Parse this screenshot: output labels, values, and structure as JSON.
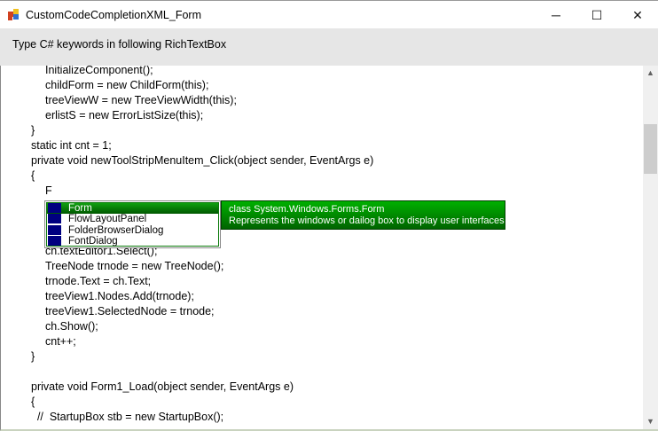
{
  "window": {
    "title": "CustomCodeCompletionXML_Form",
    "minimize": "─",
    "maximize": "☐",
    "close": "✕"
  },
  "header": {
    "label": "Type C# keywords in following RichTextBox"
  },
  "editor": {
    "lines": [
      {
        "text": "InitializeComponent();",
        "indent": 1
      },
      {
        "text": "childForm = new ChildForm(this);",
        "indent": 1
      },
      {
        "text": "treeViewW = new TreeViewWidth(this);",
        "indent": 1
      },
      {
        "text": "erlistS = new ErrorListSize(this);",
        "indent": 1
      },
      {
        "text": "}",
        "indent": 0
      },
      {
        "text": "static int cnt = 1;",
        "indent": 0
      },
      {
        "text": "private void newToolStripMenuItem_Click(object sender, EventArgs e)",
        "indent": 0
      },
      {
        "text": "{",
        "indent": 0
      },
      {
        "text": "F",
        "indent": 1
      },
      {
        "text": "",
        "indent": 1
      },
      {
        "text": "",
        "indent": 1
      },
      {
        "text": "",
        "indent": 1
      },
      {
        "text": "ch.textEditor1.Select();",
        "indent": 1
      },
      {
        "text": "TreeNode trnode = new TreeNode();",
        "indent": 1
      },
      {
        "text": "trnode.Text = ch.Text;",
        "indent": 1
      },
      {
        "text": "treeView1.Nodes.Add(trnode);",
        "indent": 1
      },
      {
        "text": "treeView1.SelectedNode = trnode;",
        "indent": 1
      },
      {
        "text": "ch.Show();",
        "indent": 1
      },
      {
        "text": "cnt++;",
        "indent": 1
      },
      {
        "text": "}",
        "indent": 0
      },
      {
        "text": "",
        "indent": 0
      },
      {
        "text": "private void Form1_Load(object sender, EventArgs e)",
        "indent": 0
      },
      {
        "text": "{",
        "indent": 0
      },
      {
        "text": "  //  StartupBox stb = new StartupBox();",
        "indent": 0
      }
    ]
  },
  "completion": {
    "items": [
      "Form",
      "FlowLayoutPanel",
      "FolderBrowserDialog",
      "FontDialog"
    ],
    "selected_index": 0
  },
  "tooltip": {
    "line1": "class System.Windows.Forms.Form",
    "line2": "Represents the windows or dailog box to display user interfaces"
  },
  "scrollbar": {
    "up": "▲",
    "down": "▼",
    "position": 0.17
  },
  "colors": {
    "tooltip_bg": "#008000",
    "item_icon": "#000080"
  }
}
